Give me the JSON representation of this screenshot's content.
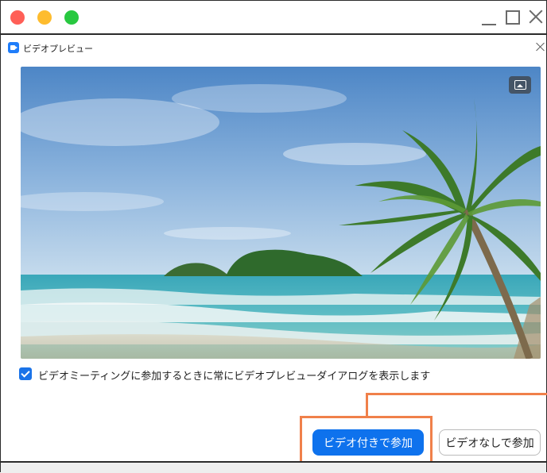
{
  "window": {
    "title": "ビデオプレビュー"
  },
  "preview": {
    "background_icon": "image-icon"
  },
  "options": {
    "always_show_preview_label": "ビデオミーティングに参加するときに常にビデオプレビューダイアログを表示します",
    "always_show_preview_checked": true
  },
  "buttons": {
    "join_with_video": "ビデオ付きで参加",
    "join_without_video": "ビデオなしで参加"
  },
  "colors": {
    "primary": "#0e72ed",
    "highlight": "#f0804a",
    "checkbox": "#1a73e8"
  }
}
